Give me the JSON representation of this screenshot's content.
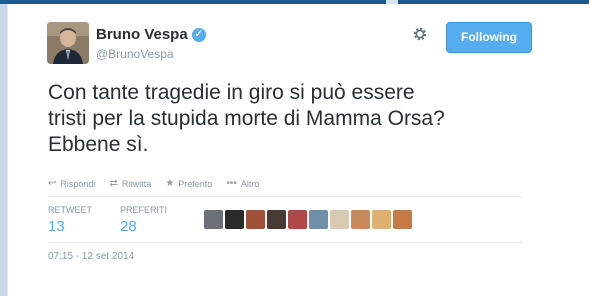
{
  "tweet": {
    "author_name": "Bruno Vespa",
    "author_handle": "@BrunoVespa",
    "follow_label": "Following",
    "text_lines": [
      "Con tante tragedie in giro si può essere",
      "tristi per la stupida morte di Mamma Orsa?",
      "Ebbene sì."
    ],
    "actions": [
      {
        "label": "Rispondi",
        "icon": "reply-icon"
      },
      {
        "label": "Ritwitta",
        "icon": "retweet-icon"
      },
      {
        "label": "Preferito",
        "icon": "star-icon"
      },
      {
        "label": "Altro",
        "icon": "more-icon"
      }
    ],
    "stats": {
      "retweet_label": "RETWEET",
      "retweet_count": "13",
      "favorites_label": "PREFERITI",
      "favorites_count": "28"
    },
    "timestamp": "07:15 - 12 set 2014"
  },
  "colors": {
    "accent": "#55acee",
    "text": "#292f33",
    "muted": "#8899a6"
  }
}
